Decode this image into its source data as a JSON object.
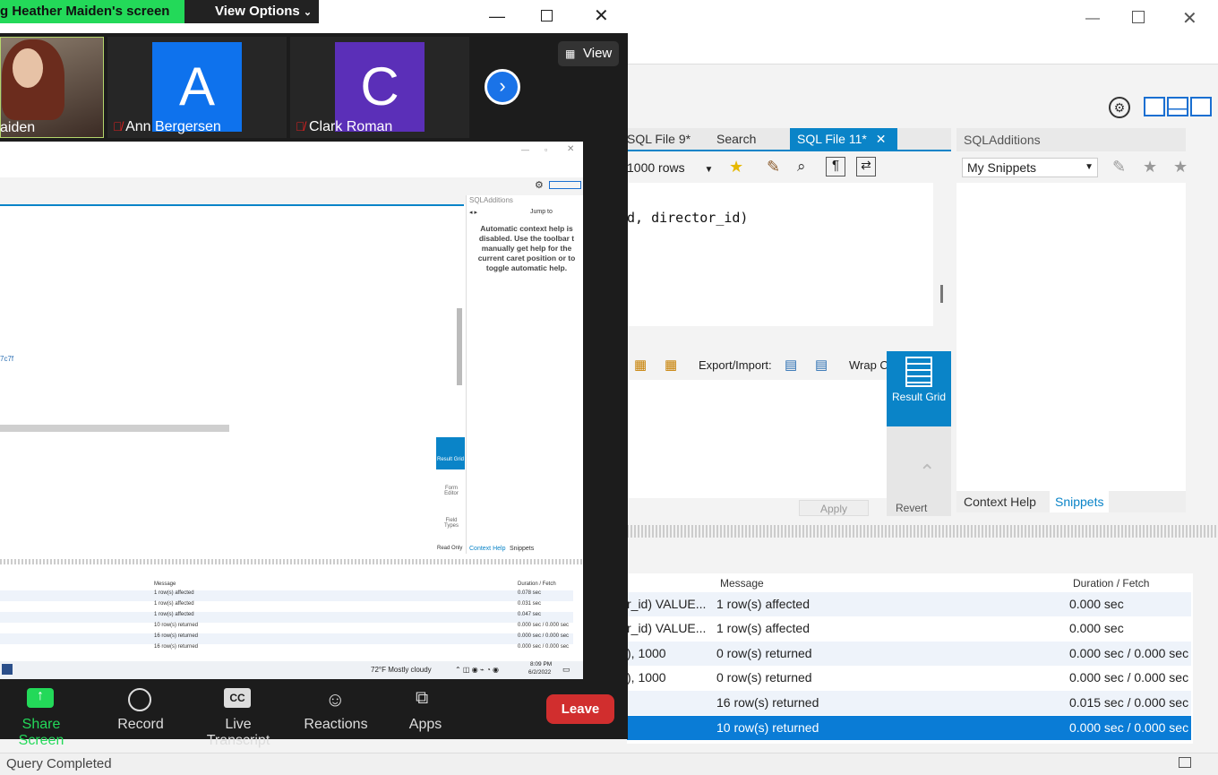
{
  "status_bar": {
    "text": "Query Completed"
  },
  "workbench": {
    "tabs": [
      "SQL File 9*",
      "Search",
      "SQL File 11*"
    ],
    "limit_rows": "1000 rows",
    "sql_snippet": "d, director_id)",
    "export_label": "Export/Import:",
    "wrap_label": "Wrap C",
    "result_grid_label": "Result Grid",
    "apply_label": "Apply",
    "revert_label": "Revert",
    "additions_title": "SQLAdditions",
    "snippets_select": "My Snippets",
    "context_help_tab": "Context Help",
    "snippets_tab": "Snippets",
    "output_headers": {
      "message": "Message",
      "duration": "Duration / Fetch"
    },
    "output_rows": [
      {
        "action": "r_id) VALUE...",
        "message": "1 row(s) affected",
        "duration": "0.000 sec"
      },
      {
        "action": "r_id) VALUE...",
        "message": "1 row(s) affected",
        "duration": "0.000 sec"
      },
      {
        "action": "), 1000",
        "message": "0 row(s) returned",
        "duration": "0.000 sec / 0.000 sec"
      },
      {
        "action": "), 1000",
        "message": "0 row(s) returned",
        "duration": "0.000 sec / 0.000 sec"
      },
      {
        "action": "",
        "message": "16 row(s) returned",
        "duration": "0.015 sec / 0.000 sec"
      },
      {
        "action": "",
        "message": "10 row(s) returned",
        "duration": "0.000 sec / 0.000 sec"
      }
    ]
  },
  "zoom": {
    "share_banner": "g Heather Maiden's screen",
    "view_options": "View Options",
    "view_button": "View",
    "participants": [
      {
        "name": "aiden",
        "muted": false
      },
      {
        "name": "Ann Bergersen",
        "initial": "A",
        "muted": true
      },
      {
        "name": "Clark Roman",
        "initial": "C",
        "muted": true
      }
    ],
    "controls": {
      "share": "Share Screen",
      "record": "Record",
      "transcript": "Live Transcript",
      "reactions": "Reactions",
      "apps": "Apps",
      "leave": "Leave"
    }
  },
  "shared_screen": {
    "additions_title": "SQLAdditions",
    "jump_to": "Jump to",
    "help_text": "Automatic context help is disabled. Use the toolbar t manually get help for the current caret position or to toggle automatic help.",
    "hex_text": "7c7f",
    "side_result": "Result Grid",
    "side_form": "Form Editor",
    "side_field": "Field Types",
    "read_only": "Read Only",
    "ctx_help": "Context Help",
    "snippets": "Snippets",
    "out_headers": {
      "message": "Message",
      "duration": "Duration / Fetch"
    },
    "out_rows": [
      {
        "message": "1 row(s) affected",
        "duration": "0.078 sec"
      },
      {
        "message": "1 row(s) affected",
        "duration": "0.031 sec"
      },
      {
        "message": "1 row(s) affected",
        "duration": "0.047 sec"
      },
      {
        "message": "10 row(s) returned",
        "duration": "0.000 sec / 0.000 sec"
      },
      {
        "message": "16 row(s) returned",
        "duration": "0.000 sec / 0.000 sec"
      },
      {
        "message": "16 row(s) returned",
        "duration": "0.000 sec / 0.000 sec"
      }
    ],
    "weather": "72°F  Mostly cloudy",
    "time": "8:09 PM",
    "date": "6/2/2022"
  }
}
